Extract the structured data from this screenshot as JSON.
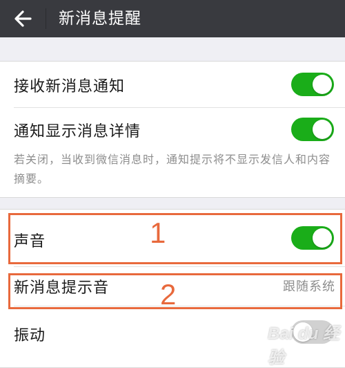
{
  "header": {
    "title": "新消息提醒",
    "back_icon": "arrow-left-icon",
    "background_color": "#393a3f"
  },
  "section1": {
    "items": [
      {
        "label": "接收新消息通知",
        "toggle": true
      },
      {
        "label": "通知显示消息详情",
        "toggle": true
      }
    ],
    "note": "若关闭，当收到微信消息时，通知提示将不显示发信人和内容摘要。"
  },
  "section2": {
    "sound": {
      "label": "声音",
      "toggle": true
    },
    "ringtone": {
      "label": "新消息提示音",
      "value": "跟随系统"
    },
    "vibrate": {
      "label": "振动",
      "toggle": false
    }
  },
  "annotations": {
    "one": "1",
    "two": "2",
    "color": "#e8693c"
  },
  "colors": {
    "toggle_on": "#1aad19",
    "toggle_off": "#d1d1d1"
  },
  "watermark": "Bai du 经验"
}
